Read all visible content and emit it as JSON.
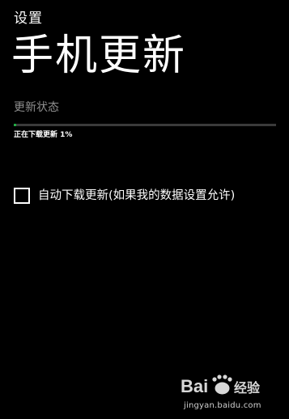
{
  "header": {
    "app_title": "设置",
    "page_title": "手机更新"
  },
  "update": {
    "section_label": "更新状态",
    "status_text": "正在下载更新 1%",
    "progress": 0.01,
    "progress_color": "#22aa44"
  },
  "options": {
    "auto_download_label": "自动下载更新(如果我的数据设置允许)",
    "auto_download_checked": false
  },
  "watermark": {
    "logo_text": "Bai 经验",
    "url": "jingyan.baidu.com"
  }
}
